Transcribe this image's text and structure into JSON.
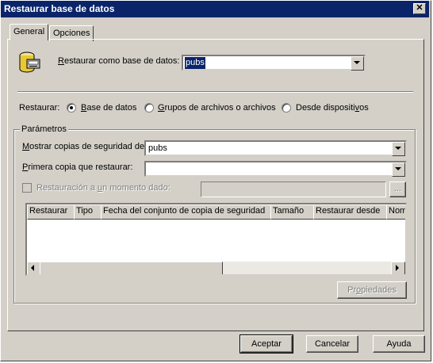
{
  "window": {
    "title": "Restaurar base de datos"
  },
  "tabs": [
    {
      "label": "General",
      "active": true
    },
    {
      "label": "Opciones",
      "active": false
    }
  ],
  "restore_as": {
    "label_prefix": "R",
    "label_rest": "estaurar como base de datos:",
    "value": "pubs"
  },
  "restore_type": {
    "label": "Restaurar:",
    "options": [
      {
        "u": "B",
        "rest": "ase de datos",
        "checked": true
      },
      {
        "u": "G",
        "rest": "rupos de archivos o archivos",
        "checked": false
      },
      {
        "pre": "Desde dispositi",
        "u": "v",
        "rest": "os",
        "checked": false
      }
    ]
  },
  "parameters": {
    "group_label": "Parámetros",
    "show_backups_label_u": "M",
    "show_backups_label_rest": "ostrar copias de seguridad de:",
    "show_backups_value": "pubs",
    "first_backup_label_u": "P",
    "first_backup_label_rest": "rimera copia que restaurar:",
    "first_backup_value": "",
    "point_in_time_pre": "Restauración a ",
    "point_in_time_u": "u",
    "point_in_time_rest": "n momento dado:",
    "point_in_time_value": "",
    "ellipsis_button": "...",
    "columns": [
      "Restaurar",
      "Tipo",
      "Fecha del conjunto de copia de seguridad",
      "Tamaño",
      "Restaurar desde",
      "Nom"
    ],
    "properties_pre": "Pr",
    "properties_u": "o",
    "properties_rest": "piedades"
  },
  "buttons": {
    "ok": "Aceptar",
    "cancel": "Cancelar",
    "help": "Ayuda"
  },
  "colors": {
    "titlebar": "#0a246a",
    "face": "#d4d0c8",
    "selection": "#0a246a"
  }
}
